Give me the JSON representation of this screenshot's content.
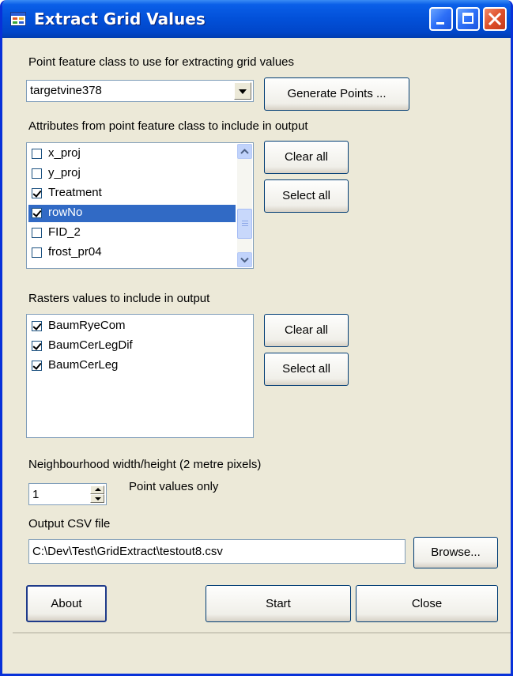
{
  "window": {
    "title": "Extract Grid Values",
    "icon": "form-icon",
    "controls": [
      "minimize-icon",
      "maximize-icon",
      "close-icon"
    ]
  },
  "point_section": {
    "label": "Point feature class to use for extracting grid values",
    "selected": "targetvine378",
    "generate_label": "Generate Points ..."
  },
  "attributes_section": {
    "label": "Attributes from point feature class to include in output",
    "items": [
      {
        "label": "x_proj",
        "checked": false,
        "selected": false
      },
      {
        "label": "y_proj",
        "checked": false,
        "selected": false
      },
      {
        "label": "Treatment",
        "checked": true,
        "selected": false
      },
      {
        "label": "rowNo",
        "checked": true,
        "selected": true
      },
      {
        "label": "FID_2",
        "checked": false,
        "selected": false
      },
      {
        "label": "frost_pr04",
        "checked": false,
        "selected": false
      }
    ],
    "clear_label": "Clear all",
    "select_label": "Select all"
  },
  "rasters_section": {
    "label": "Rasters values to include in output",
    "items": [
      {
        "label": "BaumRyeCom",
        "checked": true
      },
      {
        "label": "BaumCerLegDif",
        "checked": true
      },
      {
        "label": "BaumCerLeg",
        "checked": true
      }
    ],
    "clear_label": "Clear all",
    "select_label": "Select all"
  },
  "neighbourhood": {
    "label": "Neighbourhood width/height (2 metre pixels)",
    "value": "1",
    "note": "Point values only"
  },
  "output": {
    "label": "Output CSV file",
    "path": "C:\\Dev\\Test\\GridExtract\\testout8.csv",
    "browse_label": "Browse..."
  },
  "footer": {
    "about_label": "About",
    "start_label": "Start",
    "close_label": "Close"
  }
}
